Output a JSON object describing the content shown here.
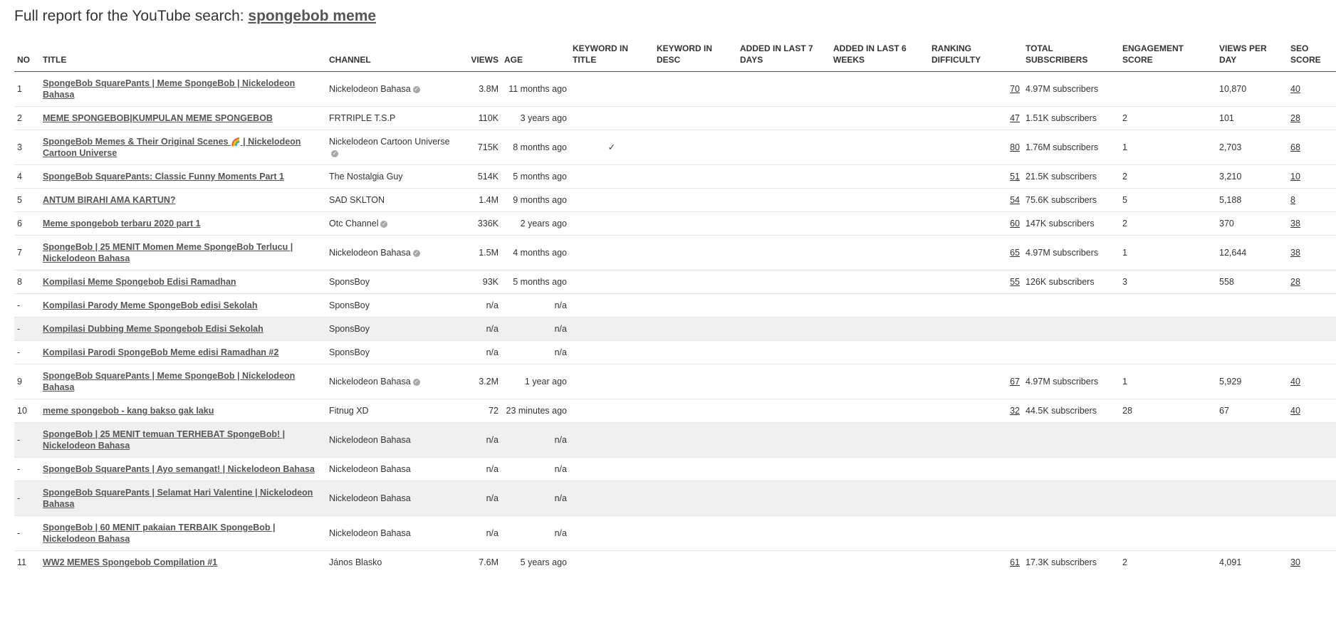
{
  "report": {
    "title_prefix": "Full report for the YouTube search:",
    "query": "spongebob meme"
  },
  "columns": {
    "no": "NO",
    "title": "TITLE",
    "channel": "CHANNEL",
    "views": "VIEWS",
    "age": "AGE",
    "kw_title": "KEYWORD IN TITLE",
    "kw_desc": "KEYWORD IN DESC",
    "added7": "ADDED IN LAST 7 DAYS",
    "added6w": "ADDED IN LAST 6 WEEKS",
    "ranking": "RANKING DIFFICULTY",
    "subs": "TOTAL SUBSCRIBERS",
    "engagement": "ENGAGEMENT SCORE",
    "vpd": "VIEWS PER DAY",
    "seo": "SEO SCORE"
  },
  "icons": {
    "verified": "verified-badge-icon",
    "rainbow": "rainbow-emoji-icon",
    "check": "checkmark-icon"
  },
  "rows": [
    {
      "no": "1",
      "title": "SpongeBob SquarePants | Meme SpongeBob | Nickelodeon Bahasa",
      "channel": "Nickelodeon Bahasa",
      "verified": true,
      "views": "3.8M",
      "age": "11 months ago",
      "kw_title": "",
      "kw_desc": "",
      "added7": "",
      "added6w": "",
      "ranking": "70",
      "subs": "4.97M subscribers",
      "engagement": "",
      "vpd": "10,870",
      "seo": "40",
      "gray": false
    },
    {
      "no": "2",
      "title": "MEME SPONGEBOB|KUMPULAN MEME SPONGEBOB",
      "channel": "FRTRIPLE T.S.P",
      "verified": false,
      "views": "110K",
      "age": "3 years ago",
      "kw_title": "",
      "kw_desc": "",
      "added7": "",
      "added6w": "",
      "ranking": "47",
      "subs": "1.51K subscribers",
      "engagement": "2",
      "vpd": "101",
      "seo": "28",
      "gray": false
    },
    {
      "no": "3",
      "title": "SpongeBob Memes & Their Original Scenes 🌈 | Nickelodeon Cartoon Universe",
      "channel": "Nickelodeon Cartoon Universe",
      "verified": true,
      "views": "715K",
      "age": "8 months ago",
      "kw_title": "✓",
      "kw_desc": "",
      "added7": "",
      "added6w": "",
      "ranking": "80",
      "subs": "1.76M subscribers",
      "engagement": "1",
      "vpd": "2,703",
      "seo": "68",
      "gray": false
    },
    {
      "no": "4",
      "title": "SpongeBob SquarePants: Classic Funny Moments Part 1",
      "channel": "The Nostalgia Guy",
      "verified": false,
      "views": "514K",
      "age": "5 months ago",
      "kw_title": "",
      "kw_desc": "",
      "added7": "",
      "added6w": "",
      "ranking": "51",
      "subs": "21.5K subscribers",
      "engagement": "2",
      "vpd": "3,210",
      "seo": "10",
      "gray": false
    },
    {
      "no": "5",
      "title": "ANTUM BIRAHI AMA KARTUN?",
      "channel": "SAD SKLTON",
      "verified": false,
      "views": "1.4M",
      "age": "9 months ago",
      "kw_title": "",
      "kw_desc": "",
      "added7": "",
      "added6w": "",
      "ranking": "54",
      "subs": "75.6K subscribers",
      "engagement": "5",
      "vpd": "5,188",
      "seo": "8",
      "gray": false
    },
    {
      "no": "6",
      "title": "Meme spongebob terbaru 2020 part 1",
      "channel": "Otc Channel",
      "verified": true,
      "views": "336K",
      "age": "2 years ago",
      "kw_title": "",
      "kw_desc": "",
      "added7": "",
      "added6w": "",
      "ranking": "60",
      "subs": "147K subscribers",
      "engagement": "2",
      "vpd": "370",
      "seo": "38",
      "gray": false
    },
    {
      "no": "7",
      "title": "SpongeBob | 25 MENIT Momen Meme SpongeBob Terlucu | Nickelodeon Bahasa",
      "channel": "Nickelodeon Bahasa",
      "verified": true,
      "views": "1.5M",
      "age": "4 months ago",
      "kw_title": "",
      "kw_desc": "",
      "added7": "",
      "added6w": "",
      "ranking": "65",
      "subs": "4.97M subscribers",
      "engagement": "1",
      "vpd": "12,644",
      "seo": "38",
      "gray": false
    },
    {
      "no": "8",
      "title": "Kompilasi Meme Spongebob Edisi Ramadhan",
      "channel": "SponsBoy",
      "verified": false,
      "views": "93K",
      "age": "5 months ago",
      "kw_title": "",
      "kw_desc": "",
      "added7": "",
      "added6w": "",
      "ranking": "55",
      "subs": "126K subscribers",
      "engagement": "3",
      "vpd": "558",
      "seo": "28",
      "gray": false
    },
    {
      "no": "-",
      "title": "Kompilasi Parody Meme SpongeBob edisi Sekolah",
      "channel": "SponsBoy",
      "verified": false,
      "views": "n/a",
      "age": "n/a",
      "kw_title": "",
      "kw_desc": "",
      "added7": "",
      "added6w": "",
      "ranking": "",
      "subs": "",
      "engagement": "",
      "vpd": "",
      "seo": "",
      "gray": false
    },
    {
      "no": "-",
      "title": "Kompilasi Dubbing Meme Spongebob Edisi Sekolah",
      "channel": "SponsBoy",
      "verified": false,
      "views": "n/a",
      "age": "n/a",
      "kw_title": "",
      "kw_desc": "",
      "added7": "",
      "added6w": "",
      "ranking": "",
      "subs": "",
      "engagement": "",
      "vpd": "",
      "seo": "",
      "gray": true
    },
    {
      "no": "-",
      "title": "Kompilasi Parodi SpongeBob Meme edisi Ramadhan #2",
      "channel": "SponsBoy",
      "verified": false,
      "views": "n/a",
      "age": "n/a",
      "kw_title": "",
      "kw_desc": "",
      "added7": "",
      "added6w": "",
      "ranking": "",
      "subs": "",
      "engagement": "",
      "vpd": "",
      "seo": "",
      "gray": false
    },
    {
      "no": "9",
      "title": "SpongeBob SquarePants | Meme SpongeBob | Nickelodeon Bahasa",
      "channel": "Nickelodeon Bahasa",
      "verified": true,
      "views": "3.2M",
      "age": "1 year ago",
      "kw_title": "",
      "kw_desc": "",
      "added7": "",
      "added6w": "",
      "ranking": "67",
      "subs": "4.97M subscribers",
      "engagement": "1",
      "vpd": "5,929",
      "seo": "40",
      "gray": false
    },
    {
      "no": "10",
      "title": "meme spongebob - kang bakso gak laku",
      "channel": "Fitnug XD",
      "verified": false,
      "views": "72",
      "age": "23 minutes ago",
      "kw_title": "",
      "kw_desc": "",
      "added7": "",
      "added6w": "",
      "ranking": "32",
      "subs": "44.5K subscribers",
      "engagement": "28",
      "vpd": "67",
      "seo": "40",
      "gray": false
    },
    {
      "no": "-",
      "title": "SpongeBob | 25 MENIT temuan TERHEBAT SpongeBob! | Nickelodeon Bahasa",
      "channel": "Nickelodeon Bahasa",
      "verified": false,
      "views": "n/a",
      "age": "n/a",
      "kw_title": "",
      "kw_desc": "",
      "added7": "",
      "added6w": "",
      "ranking": "",
      "subs": "",
      "engagement": "",
      "vpd": "",
      "seo": "",
      "gray": true
    },
    {
      "no": "-",
      "title": "SpongeBob SquarePants | Ayo semangat! | Nickelodeon Bahasa",
      "channel": "Nickelodeon Bahasa",
      "verified": false,
      "views": "n/a",
      "age": "n/a",
      "kw_title": "",
      "kw_desc": "",
      "added7": "",
      "added6w": "",
      "ranking": "",
      "subs": "",
      "engagement": "",
      "vpd": "",
      "seo": "",
      "gray": false
    },
    {
      "no": "-",
      "title": "SpongeBob SquarePants | Selamat Hari Valentine | Nickelodeon Bahasa",
      "channel": "Nickelodeon Bahasa",
      "verified": false,
      "views": "n/a",
      "age": "n/a",
      "kw_title": "",
      "kw_desc": "",
      "added7": "",
      "added6w": "",
      "ranking": "",
      "subs": "",
      "engagement": "",
      "vpd": "",
      "seo": "",
      "gray": true
    },
    {
      "no": "-",
      "title": "SpongeBob | 60 MENIT pakaian TERBAIK SpongeBob | Nickelodeon Bahasa",
      "channel": "Nickelodeon Bahasa",
      "verified": false,
      "views": "n/a",
      "age": "n/a",
      "kw_title": "",
      "kw_desc": "",
      "added7": "",
      "added6w": "",
      "ranking": "",
      "subs": "",
      "engagement": "",
      "vpd": "",
      "seo": "",
      "gray": false
    },
    {
      "no": "11",
      "title": "WW2 MEMES Spongebob Compilation #1",
      "channel": "János Blasko",
      "verified": false,
      "views": "7.6M",
      "age": "5 years ago",
      "kw_title": "",
      "kw_desc": "",
      "added7": "",
      "added6w": "",
      "ranking": "61",
      "subs": "17.3K subscribers",
      "engagement": "2",
      "vpd": "4,091",
      "seo": "30",
      "gray": false
    }
  ]
}
